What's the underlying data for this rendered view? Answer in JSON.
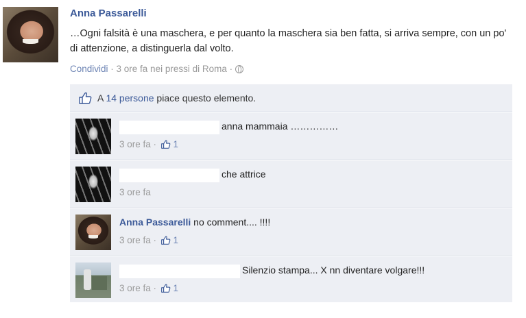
{
  "post": {
    "author": "Anna Passarelli",
    "text": "…Ogni falsità è una maschera, e per quanto la maschera sia ben fatta, si arriva sempre, con un po' di attenzione, a distinguerla dal volto.",
    "share_label": "Condividi",
    "sep1": " · ",
    "time_location": "3 ore fa nei pressi di Roma",
    "sep2": " · "
  },
  "likes": {
    "prefix": "A ",
    "count_link": "14 persone",
    "suffix": " piace questo elemento."
  },
  "comments": [
    {
      "author": "",
      "text": "anna mammaia ……………",
      "time": "3 ore fa",
      "sep": " · ",
      "likes": "1"
    },
    {
      "author": "",
      "text": "che attrice",
      "time": "3 ore fa",
      "sep": "",
      "likes": ""
    },
    {
      "author": "Anna Passarelli",
      "text": "no comment.... !!!!",
      "time": "3 ore fa",
      "sep": " · ",
      "likes": "1"
    },
    {
      "author": "",
      "text": "Silenzio stampa... X nn diventare volgare!!!",
      "time": "3 ore fa",
      "sep": " · ",
      "likes": "1"
    }
  ],
  "icons": {
    "globe": "globe-icon",
    "like": "thumbs-up-icon"
  },
  "colors": {
    "link": "#3b5998",
    "muted": "#999999",
    "comments_bg": "#edeff4"
  }
}
